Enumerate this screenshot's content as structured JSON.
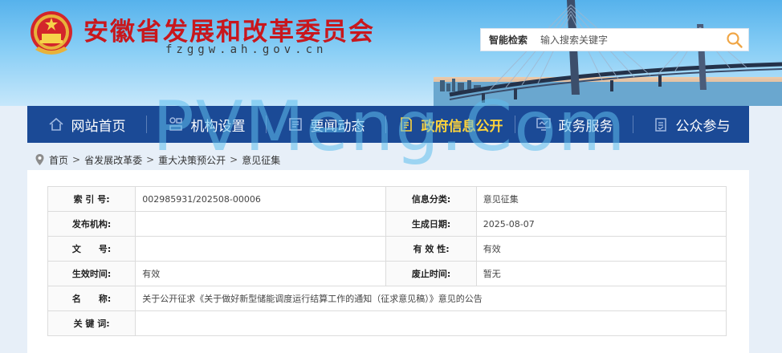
{
  "header": {
    "title": "安徽省发展和改革委员会",
    "domain": "fzggw.ah.gov.cn"
  },
  "search": {
    "label": "智能检索",
    "placeholder": "输入搜索关键字",
    "icon": "search-icon"
  },
  "nav": {
    "items": [
      {
        "label": "网站首页",
        "icon": "home-icon"
      },
      {
        "label": "机构设置",
        "icon": "org-chart-icon"
      },
      {
        "label": "要闻动态",
        "icon": "newspaper-icon"
      },
      {
        "label": "政府信息公开",
        "icon": "document-icon",
        "active": true
      },
      {
        "label": "政务服务",
        "icon": "monitor-icon"
      },
      {
        "label": "公众参与",
        "icon": "clipboard-icon"
      }
    ],
    "active_color": "#ffd43b",
    "background_color": "#1b4a96"
  },
  "breadcrumb": [
    "首页",
    "省发展改革委",
    "重大决策预公开",
    "意见征集"
  ],
  "meta_table": {
    "index_no_label": "索 引 号:",
    "index_no": "002985931/202508-00006",
    "category_label": "信息分类:",
    "category": "意见征集",
    "publisher_label": "发布机构:",
    "publisher": "",
    "created_label": "生成日期:",
    "created": "2025-08-07",
    "doc_no_label": "文　　号:",
    "doc_no": "",
    "validity_label": "有 效 性:",
    "validity": "有效",
    "effective_label": "生效时间:",
    "effective": "有效",
    "expire_label": "废止时间:",
    "expire": "暂无",
    "name_label": "名　　称:",
    "name": "关于公开征求《关于做好新型储能调度运行结算工作的通知（征求意见稿）》意见的公告",
    "keywords_label": "关 键 词:",
    "keywords": ""
  },
  "watermark": "PVMeng.Com"
}
